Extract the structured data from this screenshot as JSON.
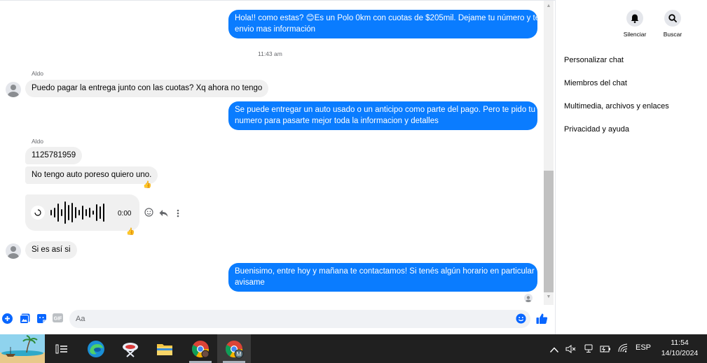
{
  "messages": {
    "m1": {
      "line1": "Hola!! como estas? 😊Es un Polo 0km con cuotas de $205mil. Dejame tu número y te",
      "line2": "envio mas información"
    },
    "time1": "11:43 am",
    "sender": "Aldo",
    "m2": "Puedo pagar la entrega junto con las cuotas? Xq ahora no tengo",
    "m3": {
      "line1": "Se puede entregar un auto usado o un anticipo como parte del pago. Pero te pido tu",
      "line2": "numero para pasarte mejor toda la informacion y detalles"
    },
    "m4": "1125781959",
    "m5": "No tengo auto poreso quiero uno.",
    "audio_duration": "0:00",
    "m6": "Si es así si",
    "m7": {
      "line1": "Buenisimo, entre hoy y mañana te contactamos! Si tenés algún horario en particular",
      "line2": "avisame"
    },
    "reaction": "👍"
  },
  "panel": {
    "mute_label": "Silenciar",
    "search_label": "Buscar",
    "menu": [
      "Personalizar chat",
      "Miembros del chat",
      "Multimedia, archivos y enlaces",
      "Privacidad y ayuda"
    ]
  },
  "composer": {
    "placeholder": "Aa"
  },
  "taskbar": {
    "lang": "ESP",
    "time": "11:54",
    "date": "14/10/2024"
  },
  "colors": {
    "outgoing_bubble": "#0a7cff",
    "incoming_bubble": "#f0f0f0",
    "accent": "#0866ff",
    "taskbar": "#202020"
  },
  "icons": [
    "bell-icon",
    "search-icon",
    "plus-icon",
    "image-icon",
    "sticker-icon",
    "gif-icon",
    "emoji-icon",
    "like-icon",
    "play-icon",
    "react-icon",
    "reply-icon",
    "more-icon",
    "task-view-icon",
    "edge-icon",
    "snipping-tool-icon",
    "file-explorer-icon",
    "chrome-icon",
    "chrome-profile-icon",
    "chevron-up-icon",
    "volume-muted-icon",
    "meet-icon",
    "power-icon",
    "wifi-icon"
  ]
}
